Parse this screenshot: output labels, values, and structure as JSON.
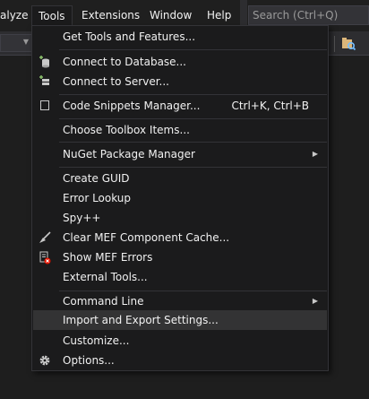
{
  "menubar": {
    "partial_label": "alyze",
    "items": [
      "Tools",
      "Extensions",
      "Window",
      "Help"
    ],
    "search_placeholder": "Search (Ctrl+Q)"
  },
  "menu": {
    "items": [
      {
        "label": "Get Tools and Features...",
        "shortcut": "",
        "icon": "",
        "submenu": false
      },
      {
        "label": "Connect to Database...",
        "shortcut": "",
        "icon": "connect-database-icon",
        "submenu": false
      },
      {
        "label": "Connect to Server...",
        "shortcut": "",
        "icon": "connect-server-icon",
        "submenu": false
      },
      {
        "label": "Code Snippets Manager...",
        "shortcut": "Ctrl+K, Ctrl+B",
        "icon": "checkbox-icon",
        "submenu": false
      },
      {
        "label": "Choose Toolbox Items...",
        "shortcut": "",
        "icon": "",
        "submenu": false
      },
      {
        "label": "NuGet Package Manager",
        "shortcut": "",
        "icon": "",
        "submenu": true
      },
      {
        "label": "Create GUID",
        "shortcut": "",
        "icon": "",
        "submenu": false
      },
      {
        "label": "Error Lookup",
        "shortcut": "",
        "icon": "",
        "submenu": false
      },
      {
        "label": "Spy++",
        "shortcut": "",
        "icon": "",
        "submenu": false
      },
      {
        "label": "Clear MEF Component Cache...",
        "shortcut": "",
        "icon": "broom-icon",
        "submenu": false
      },
      {
        "label": "Show MEF Errors",
        "shortcut": "",
        "icon": "mef-errors-icon",
        "submenu": false
      },
      {
        "label": "External Tools...",
        "shortcut": "",
        "icon": "",
        "submenu": false
      },
      {
        "label": "Command Line",
        "shortcut": "",
        "icon": "",
        "submenu": true
      },
      {
        "label": "Import and Export Settings...",
        "shortcut": "",
        "icon": "",
        "submenu": false
      },
      {
        "label": "Customize...",
        "shortcut": "",
        "icon": "",
        "submenu": false
      },
      {
        "label": "Options...",
        "shortcut": "",
        "icon": "gear-icon",
        "submenu": false
      }
    ],
    "highlighted_item": "Import and Export Settings..."
  },
  "colors": {
    "menu_bg": "#1b1b1c",
    "highlight": "#333334",
    "text": "#f1f1f1",
    "icon_green": "#8ac06b",
    "icon_red": "#e51400"
  }
}
